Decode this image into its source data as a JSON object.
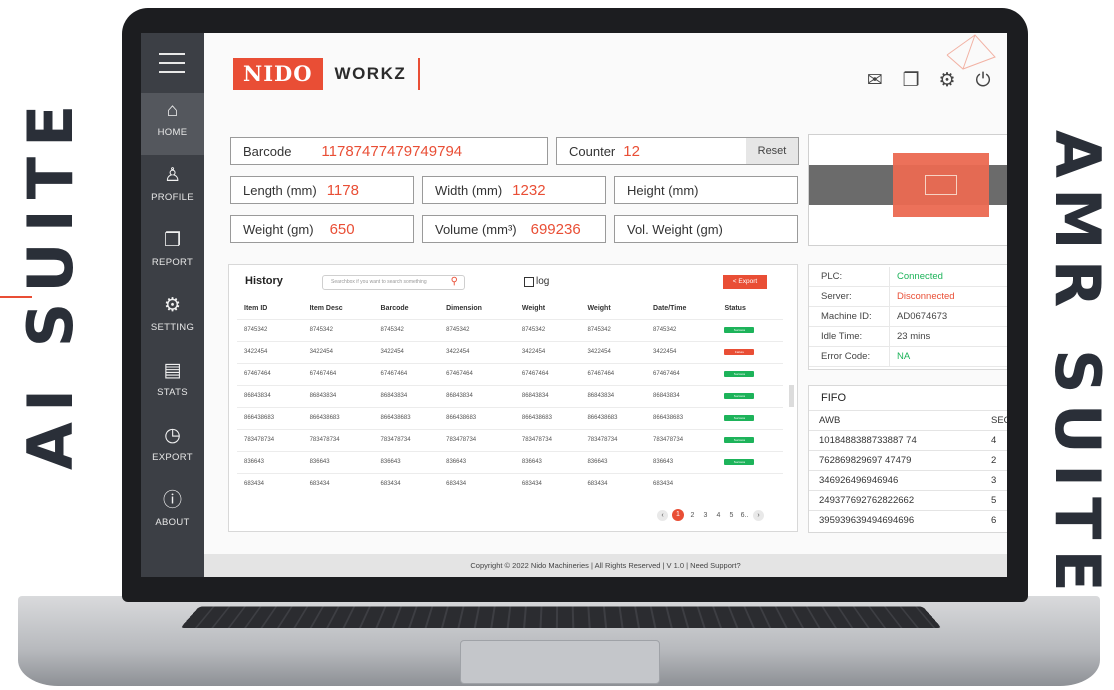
{
  "side": {
    "left_title": "AI SUITE",
    "right_title": "AMR SUITE"
  },
  "brand": {
    "logo_primary": "NIDO",
    "logo_secondary": "WORKZ",
    "accent": "#e94e35",
    "sidebar_bg": "#3c3f45"
  },
  "sidebar": {
    "items": [
      {
        "label": "HOME",
        "icon": "home-icon"
      },
      {
        "label": "PROFILE",
        "icon": "user-icon"
      },
      {
        "label": "REPORT",
        "icon": "report-icon"
      },
      {
        "label": "SETTING",
        "icon": "gear-icon"
      },
      {
        "label": "STATS",
        "icon": "stats-icon"
      },
      {
        "label": "EXPORT",
        "icon": "clock-icon"
      },
      {
        "label": "ABOUT",
        "icon": "info-icon"
      }
    ]
  },
  "header": {
    "icons": [
      "mail-icon",
      "copy-icon",
      "gear-icon",
      "power-icon"
    ]
  },
  "fields": {
    "barcode": {
      "label": "Barcode",
      "value": "11787477479749794"
    },
    "counter": {
      "label": "Counter",
      "value": "12",
      "reset_label": "Reset"
    },
    "length": {
      "label": "Length (mm)",
      "value": "1178"
    },
    "width": {
      "label": "Width (mm)",
      "value": "1232"
    },
    "height": {
      "label": "Height (mm)",
      "value": ""
    },
    "weight": {
      "label": "Weight (gm)",
      "value": "650"
    },
    "volume": {
      "label": "Volume (mm³)",
      "value": "699236"
    },
    "vol_weight": {
      "label": "Vol. Weight (gm)",
      "value": ""
    }
  },
  "history": {
    "title": "History",
    "search_placeholder": "Searchbox if you want to search something",
    "log_label": "log",
    "export_label": "Export",
    "columns": [
      "Item ID",
      "Item Desc",
      "Barcode",
      "Dimension",
      "Weight",
      "Weight",
      "Date/Time",
      "Status"
    ],
    "rows": [
      {
        "v": "8745342",
        "status": "Success",
        "state": "ok"
      },
      {
        "v": "3422454",
        "status": "Failure",
        "state": "fail"
      },
      {
        "v": "67467464",
        "status": "Success",
        "state": "ok"
      },
      {
        "v": "86843834",
        "status": "Success",
        "state": "ok"
      },
      {
        "v": "866438683",
        "status": "Success",
        "state": "ok"
      },
      {
        "v": "783478734",
        "status": "Success",
        "state": "ok"
      },
      {
        "v": "836643",
        "status": "Success",
        "state": "ok"
      },
      {
        "v": "683434",
        "status": "",
        "state": ""
      }
    ],
    "pagination": [
      "1",
      "2",
      "3",
      "4",
      "5",
      "6.."
    ],
    "current_page": "1"
  },
  "status_panel": [
    {
      "key": "PLC:",
      "value": "Connected",
      "color": "#1db35a"
    },
    {
      "key": "Server:",
      "value": "Disconnected",
      "color": "#e94e35"
    },
    {
      "key": "Machine ID:",
      "value": "AD0674673",
      "color": "#444444"
    },
    {
      "key": "Idle Time:",
      "value": "23 mins",
      "color": "#444444"
    },
    {
      "key": "Error Code:",
      "value": "NA",
      "color": "#1db35a"
    }
  ],
  "fifo": {
    "title": "FIFO",
    "columns": [
      "AWB",
      "SEQ"
    ],
    "rows": [
      {
        "awb": "1018488388733887 74",
        "seq": "4"
      },
      {
        "awb": "762869829697 47479",
        "seq": "2"
      },
      {
        "awb": "346926496946946",
        "seq": "3"
      },
      {
        "awb": "249377692762822662",
        "seq": "5"
      },
      {
        "awb": "395939639494694696",
        "seq": "6"
      }
    ]
  },
  "footer": {
    "text": "Copyright © 2022 Nido Machineries | All Rights Reserved | V 1.0 | Need Support?"
  }
}
